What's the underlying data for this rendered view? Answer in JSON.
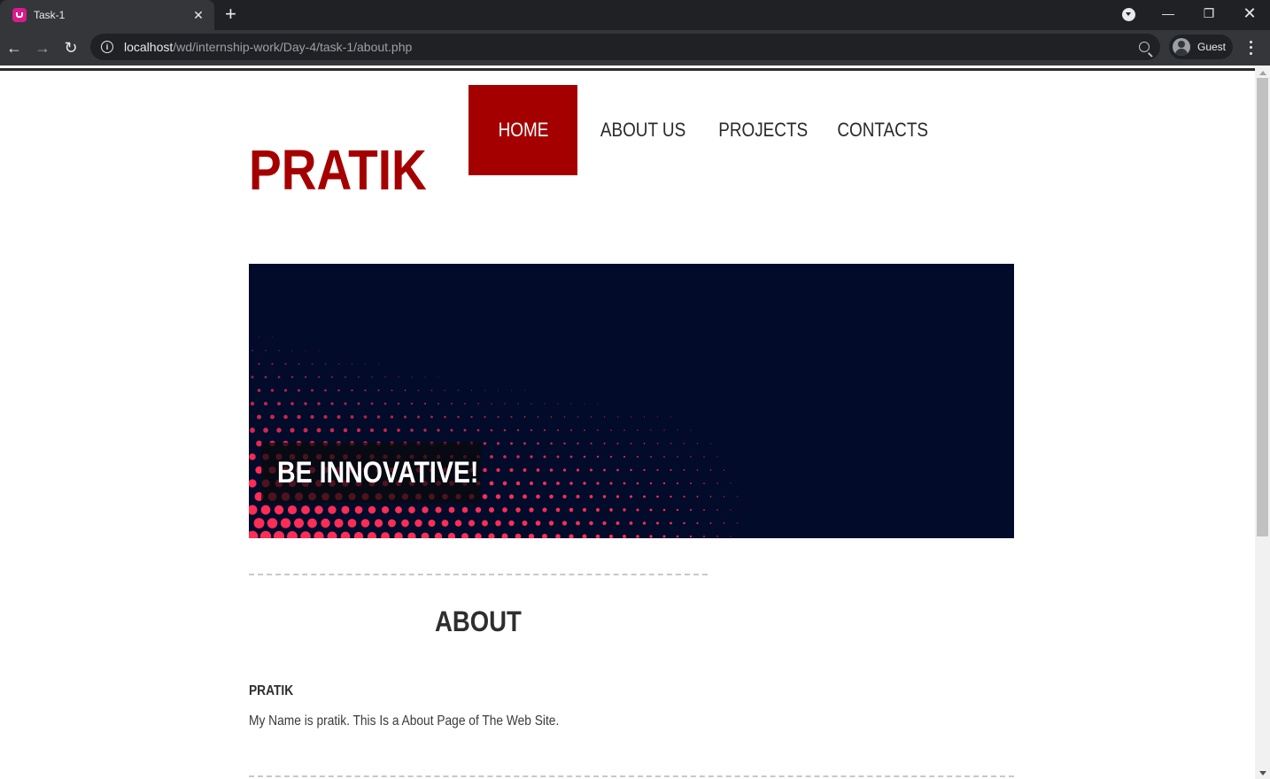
{
  "browser": {
    "tab_title": "Task-1",
    "url_host": "localhost",
    "url_path": "/wd/internship-work/Day-4/task-1/about.php",
    "profile_label": "Guest"
  },
  "site": {
    "logo": "PRATIK",
    "nav": [
      {
        "label": "HOME",
        "active": true
      },
      {
        "label": "ABOUT US",
        "active": false
      },
      {
        "label": "PROJECTS",
        "active": false
      },
      {
        "label": "CONTACTS",
        "active": false
      }
    ],
    "hero_caption": "BE INNOVATIVE!",
    "about": {
      "heading": "ABOUT",
      "name": "PRATIK",
      "text": "My Name is pratik. This Is a About Page of The Web Site."
    }
  },
  "colors": {
    "brand_red": "#a50000",
    "hero_bg": "#020b2a",
    "dot_color": "#ff2d55"
  },
  "icons": [
    "favicon-icon",
    "close-icon",
    "plus-icon",
    "tab-search-icon",
    "minimize-icon",
    "restore-icon",
    "back-icon",
    "forward-icon",
    "reload-icon",
    "info-icon",
    "zoom-icon",
    "avatar-icon",
    "more-icon"
  ]
}
